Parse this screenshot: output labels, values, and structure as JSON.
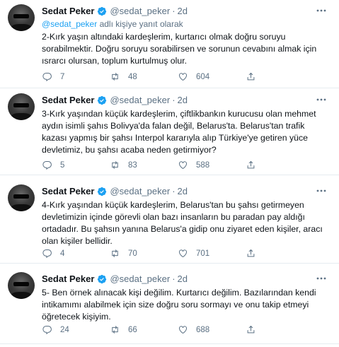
{
  "tweets": [
    {
      "name": "Sedat Peker",
      "handle": "@sedat_peker",
      "separator": "·",
      "time": "2d",
      "reply_to_mention": "@sedat_peker",
      "reply_to_suffix": " adlı kişiye yanıt olarak",
      "text": "2-Kırk yaşın altındaki kardeşlerim, kurtarıcı olmak doğru soruyu sorabilmektir. Doğru soruyu sorabilirsen ve sorunun cevabını almak için ısrarcı olursan, toplum kurtulmuş olur.",
      "replies": "7",
      "retweets": "48",
      "likes": "604"
    },
    {
      "name": "Sedat Peker",
      "handle": "@sedat_peker",
      "separator": "·",
      "time": "2d",
      "text": "3-Kırk yaşından küçük kardeşlerim, çiftlikbankın kurucusu olan mehmet aydın isimli şahıs Bolivya'da falan değil, Belarus'ta. Belarus'tan trafik kazası yapmış bir şahsı Interpol kararıyla alıp Türkiye'ye getiren yüce devletimiz, bu şahsı acaba neden getirmiyor?",
      "replies": "5",
      "retweets": "83",
      "likes": "588"
    },
    {
      "name": "Sedat Peker",
      "handle": "@sedat_peker",
      "separator": "·",
      "time": "2d",
      "text": "4-Kırk yaşından küçük kardeşlerim, Belarus'tan bu şahsı getirmeyen devletimizin içinde görevli olan bazı insanların bu paradan pay aldığı ortadadır. Bu şahsın yanına Belarus'a gidip onu ziyaret eden kişiler, aracı olan kişiler bellidir.",
      "replies": "4",
      "retweets": "70",
      "likes": "701"
    },
    {
      "name": "Sedat Peker",
      "handle": "@sedat_peker",
      "separator": "·",
      "time": "2d",
      "text": "5- Ben örnek alınacak kişi değilim. Kurtarıcı değilim. Bazılarından kendi intikamımı alabilmek için size doğru soru sormayı ve onu takip etmeyi öğretecek kişiyim.",
      "replies": "24",
      "retweets": "66",
      "likes": "688"
    }
  ],
  "icons": {
    "verified": "verified-badge-icon",
    "more": "more-icon",
    "reply": "reply-icon",
    "retweet": "retweet-icon",
    "like": "heart-icon",
    "share": "share-icon"
  },
  "colors": {
    "verified": "#1da1f2",
    "secondary_text": "#5b7083",
    "mention": "#1da1f2",
    "divider": "#e6ecf0"
  }
}
